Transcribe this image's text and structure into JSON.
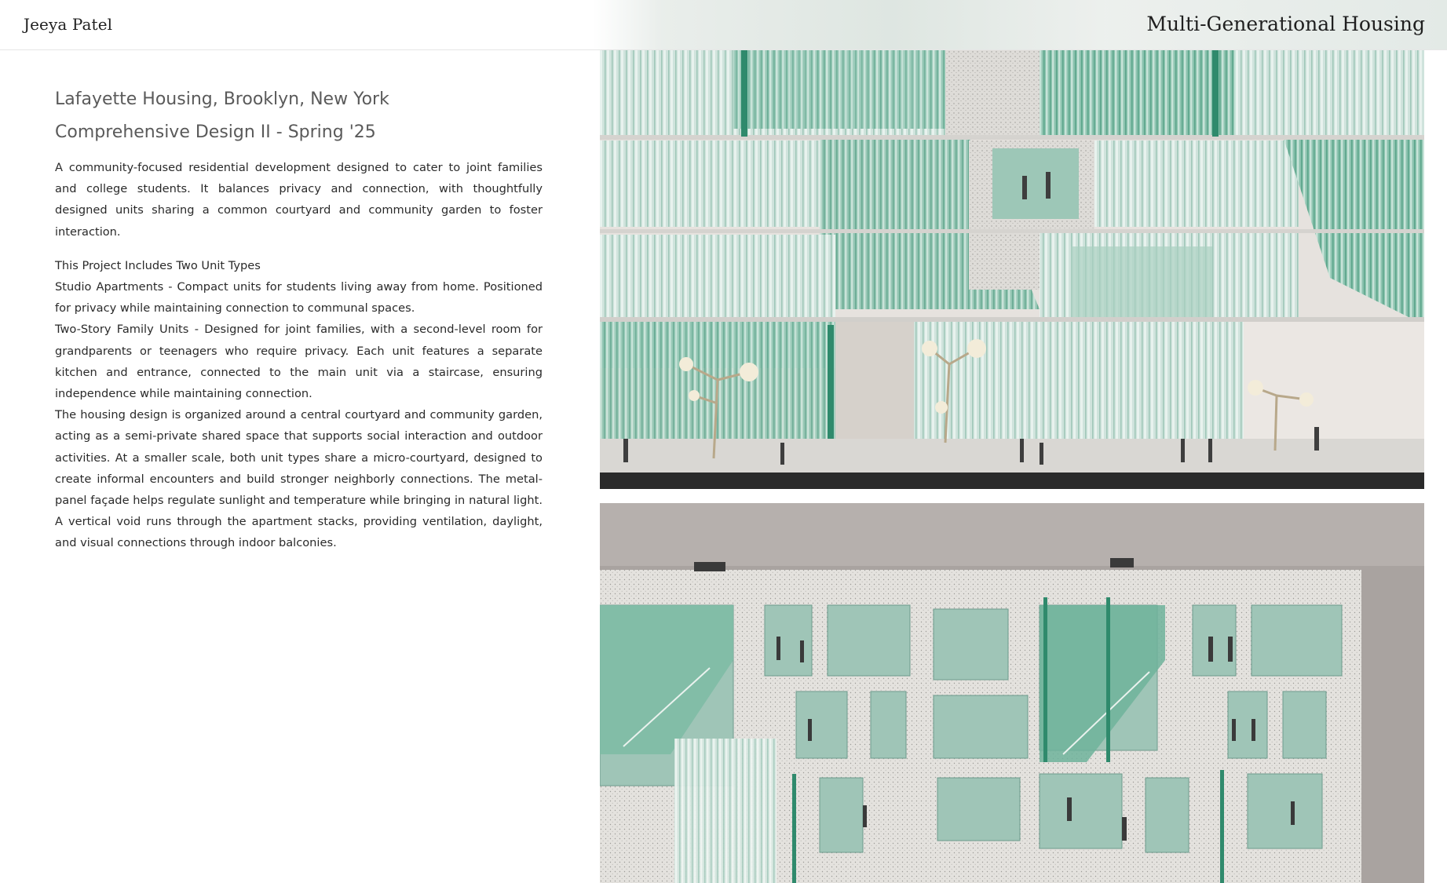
{
  "header": {
    "brand": "Jeeya Patel",
    "title": "Multi-Generational Housing"
  },
  "project": {
    "location": "Lafayette Housing, Brooklyn, New York",
    "course": "Comprehensive Design II - Spring '25",
    "intro": "A community-focused residential development designed to cater to joint families and college students. It balances privacy and connection, with thoughtfully designed units sharing a common courtyard and community garden to foster interaction.",
    "unit_types_heading": "This Project Includes Two Unit Types",
    "studio": "Studio Apartments - Compact units for students living away from home. Positioned for privacy while maintaining connection to communal spaces.",
    "family": "Two-Story Family Units - Designed for joint families, with a second-level room for grandparents or teenagers who require privacy. Each unit features a separate kitchen and entrance, connected to the main unit via a staircase, ensuring independence while maintaining connection.",
    "design": "The housing design is organized around a central courtyard and community garden, acting as a semi-private shared space that supports social interaction and outdoor activities. At a smaller scale, both unit types share a micro-courtyard, designed to create informal encounters and build stronger neighborly connections. The metal-panel façade helps regulate sunlight and temperature while bringing in natural light. A vertical void runs through the apartment stacks, providing ventilation, daylight, and visual connections through indoor balconies."
  },
  "colors": {
    "glass": "#8fc2b0",
    "glass_dark": "#2f8a6c",
    "frame": "#dcdcd8",
    "background_photo": "#e9e5e2"
  }
}
